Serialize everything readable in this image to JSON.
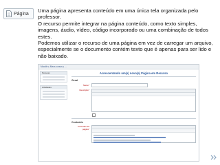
{
  "icon": {
    "name": "page-resource-icon",
    "label": "Página"
  },
  "description": {
    "paragraph1": "Uma página apresenta conteúdo em uma única tela organizada pelo professor.",
    "paragraph2": " O recurso permite integrar na página conteúdo, como texto simples, imagens, áudio, vídeo, código incorporado ou uma combinação de todos estes.",
    "paragraph3": "Podemos utilizar o recurso de uma página em vez de carregar um arquivo, especialmente se o documento contém texto que é apenas para ser lido e não baixado."
  },
  "screenshot": {
    "breadcrumb": "Moodle ▸ Meus cursos ▸ ...",
    "title": "Acrescentando um(a) novo(a) Página em Recurso",
    "block1": "Pessoas",
    "block2": "Atividades",
    "section_general": "Geral",
    "field_name": "Nome*",
    "field_description": "Descrição*",
    "section_content": "Conteúdo",
    "field_content": "Conteúdo da página*"
  },
  "colors": {
    "accent": "#2b5a9e",
    "required": "#b20000",
    "chevron": "#8aa4bf"
  }
}
